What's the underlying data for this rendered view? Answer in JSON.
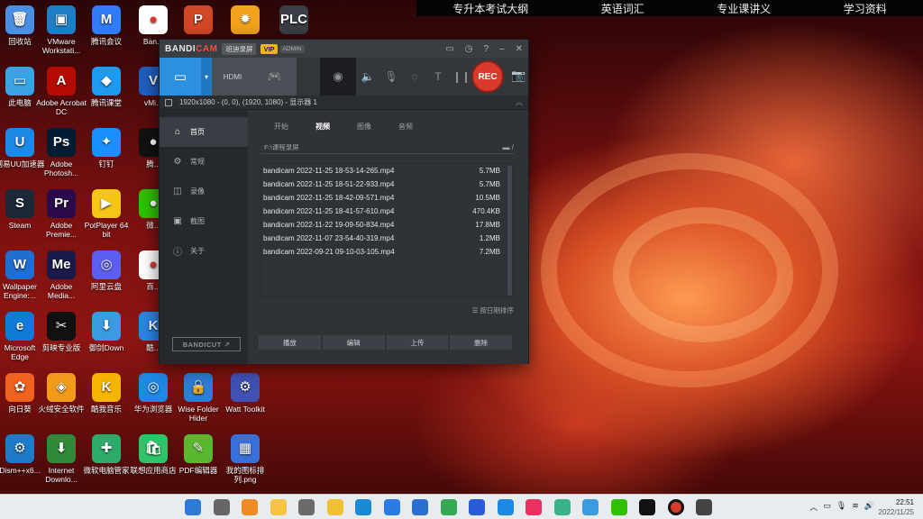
{
  "top_banner": [
    "专升本考试大纲",
    "英语词汇",
    "专业课讲义",
    "学习资料"
  ],
  "desktop_icons": [
    {
      "label": "回收站",
      "icon": "recycle-bin-icon",
      "color": "#4a90e2",
      "glyph": "🗑"
    },
    {
      "label": "VMware Workstati...",
      "icon": "vmware-icon",
      "color": "#1d7ec6",
      "glyph": "▣"
    },
    {
      "label": "腾讯会议",
      "icon": "tencent-meeting-icon",
      "color": "#2f7cf6",
      "glyph": "M"
    },
    {
      "label": "Ban...",
      "icon": "bandicam-icon",
      "color": "#ffffff",
      "glyph": "●"
    },
    {
      "label": "PowerPoint",
      "icon": "powerpoint-icon",
      "color": "#d24726",
      "glyph": "P"
    },
    {
      "label": "X1...",
      "icon": "x-app-icon",
      "color": "#f2a21b",
      "glyph": "✹"
    },
    {
      "label": "PLC SIM",
      "icon": "plcsim-icon",
      "color": "#3a3f46",
      "glyph": "PLC"
    },
    {
      "label": "此电脑",
      "icon": "this-pc-icon",
      "color": "#3aa3e3",
      "glyph": "▭"
    },
    {
      "label": "Adobe Acrobat DC",
      "icon": "acrobat-icon",
      "color": "#b30b00",
      "glyph": "A"
    },
    {
      "label": "腾讯课堂",
      "icon": "tencent-class-icon",
      "color": "#1e9bf0",
      "glyph": "◆"
    },
    {
      "label": "vMi...",
      "icon": "vmix-icon",
      "color": "#1f5fbf",
      "glyph": "V"
    },
    {
      "label": "网易UU加速器",
      "icon": "uu-accelerator-icon",
      "color": "#1e88e5",
      "glyph": "U"
    },
    {
      "label": "Adobe Photosh...",
      "icon": "photoshop-icon",
      "color": "#001d34",
      "glyph": "Ps"
    },
    {
      "label": "钉钉",
      "icon": "dingtalk-icon",
      "color": "#1890ff",
      "glyph": "✦"
    },
    {
      "label": "腾...",
      "icon": "tencent-app-icon",
      "color": "#111111",
      "glyph": "●"
    },
    {
      "label": "Steam",
      "icon": "steam-icon",
      "color": "#1b2838",
      "glyph": "S"
    },
    {
      "label": "Adobe Premie...",
      "icon": "premiere-icon",
      "color": "#2a0a4a",
      "glyph": "Pr"
    },
    {
      "label": "PotPlayer 64 bit",
      "icon": "potplayer-icon",
      "color": "#f5c518",
      "glyph": "▶"
    },
    {
      "label": "微...",
      "icon": "wechat-icon",
      "color": "#2dc100",
      "glyph": "●"
    },
    {
      "label": "Wallpaper Engine:...",
      "icon": "wallpaper-engine-icon",
      "color": "#1f6fd1",
      "glyph": "W"
    },
    {
      "label": "Adobe Media...",
      "icon": "media-encoder-icon",
      "color": "#1a1a4a",
      "glyph": "Me"
    },
    {
      "label": "阿里云盘",
      "icon": "aliyun-drive-icon",
      "color": "#5b5ff0",
      "glyph": "◎"
    },
    {
      "label": "百...",
      "icon": "baidu-icon",
      "color": "#ffffff",
      "glyph": "●"
    },
    {
      "label": "Microsoft Edge",
      "icon": "edge-icon",
      "color": "#0f7ad8",
      "glyph": "e"
    },
    {
      "label": "剪映专业版",
      "icon": "jianying-icon",
      "color": "#111111",
      "glyph": "✂"
    },
    {
      "label": "御剑Down",
      "icon": "down-icon",
      "color": "#3a9be0",
      "glyph": "⬇"
    },
    {
      "label": "酷...",
      "icon": "kugou-icon",
      "color": "#2a85e8",
      "glyph": "K"
    },
    {
      "label": "向日葵",
      "icon": "sunflower-icon",
      "color": "#f0621e",
      "glyph": "✿"
    },
    {
      "label": "火绒安全软件",
      "icon": "huorong-icon",
      "color": "#f29a1a",
      "glyph": "◈"
    },
    {
      "label": "酷我音乐",
      "icon": "kuwo-icon",
      "color": "#f5b400",
      "glyph": "K"
    },
    {
      "label": "华为浏览器",
      "icon": "huawei-browser-icon",
      "color": "#1e88e5",
      "glyph": "◎"
    },
    {
      "label": "Wise Folder Hider",
      "icon": "wise-folder-icon",
      "color": "#2e7dd6",
      "glyph": "🔒"
    },
    {
      "label": "Watt Toolkit",
      "icon": "watt-toolkit-icon",
      "color": "#3f51b5",
      "glyph": "⚙"
    },
    {
      "label": "Dism++x6...",
      "icon": "dism-icon",
      "color": "#1f7ac9",
      "glyph": "⚙"
    },
    {
      "label": "Internet Downlo...",
      "icon": "idm-icon",
      "color": "#2f8a3a",
      "glyph": "⬇"
    },
    {
      "label": "微软电脑管家",
      "icon": "pc-manager-icon",
      "color": "#2eaa6a",
      "glyph": "✚"
    },
    {
      "label": "联想应用商店",
      "icon": "lenovo-store-icon",
      "color": "#2dc46a",
      "glyph": "🛍"
    },
    {
      "label": "PDF编辑器",
      "icon": "pdf-editor-icon",
      "color": "#5ab82f",
      "glyph": "✎"
    },
    {
      "label": "我的图标排列.png",
      "icon": "png-file-icon",
      "color": "#3b6fd8",
      "glyph": "▦"
    }
  ],
  "bandicam": {
    "logo_prefix": "BANDI",
    "logo_suffix": "CAM",
    "chip_label": "班迪录屏",
    "vip_label": "VIP",
    "admin_label": "ADMIN",
    "region_text": "1920x1080 - (0, 0), (1920, 1080) - 显示器 1",
    "rec_label": "REC",
    "hdmi_label": "HDMI",
    "sidebar": [
      {
        "label": "首页",
        "icon": "home-icon",
        "glyph": "⌂",
        "active": true
      },
      {
        "label": "常规",
        "icon": "gear-icon",
        "glyph": "⚙",
        "active": false
      },
      {
        "label": "录像",
        "icon": "video-record-icon",
        "glyph": "◫",
        "active": false
      },
      {
        "label": "截图",
        "icon": "screenshot-icon",
        "glyph": "▣",
        "active": false
      },
      {
        "label": "关于",
        "icon": "info-icon",
        "glyph": "ⓘ",
        "active": false
      }
    ],
    "bandicut_label": "BANDICUT",
    "tabs": [
      {
        "label": "开始",
        "active": false
      },
      {
        "label": "视频",
        "active": true
      },
      {
        "label": "图像",
        "active": false
      },
      {
        "label": "音频",
        "active": false
      }
    ],
    "path": "F:\\课程录屏",
    "files": [
      {
        "name": "bandicam 2022-11-25 18-53-14-265.mp4",
        "size": "5.7MB"
      },
      {
        "name": "bandicam 2022-11-25 18-51-22-933.mp4",
        "size": "5.7MB"
      },
      {
        "name": "bandicam 2022-11-25 18-42-09-571.mp4",
        "size": "10.5MB"
      },
      {
        "name": "bandicam 2022-11-25 18-41-57-610.mp4",
        "size": "470.4KB"
      },
      {
        "name": "bandicam 2022-11-22 19-09-50-834.mp4",
        "size": "17.8MB"
      },
      {
        "name": "bandicam 2022-11-07 23-54-40-319.mp4",
        "size": "1.2MB"
      },
      {
        "name": "bandicam 2022-09-21 09-10-03-105.mp4",
        "size": "7.2MB"
      }
    ],
    "sort_label": "按日期排序",
    "actions": [
      "播放",
      "编辑",
      "上传",
      "删除"
    ]
  },
  "taskbar": {
    "clock_time": "22:51",
    "clock_date": "2022/11/25",
    "icons": [
      {
        "name": "start-icon",
        "color": "#2c7ad6"
      },
      {
        "name": "task-view-icon",
        "color": "#666666"
      },
      {
        "name": "search-icon",
        "color": "#f08a24"
      },
      {
        "name": "file-explorer-icon",
        "color": "#f5c542"
      },
      {
        "name": "settings-icon",
        "color": "#6a6a6a"
      },
      {
        "name": "notes-icon",
        "color": "#f0c030"
      },
      {
        "name": "edge-icon",
        "color": "#1a8ad4"
      },
      {
        "name": "kugou-icon",
        "color": "#2a7be4"
      },
      {
        "name": "l-app-icon",
        "color": "#2a6fd0"
      },
      {
        "name": "chrome-icon",
        "color": "#34a853"
      },
      {
        "name": "store-icon",
        "color": "#2a5bd7"
      },
      {
        "name": "browser-icon",
        "color": "#1e88e5"
      },
      {
        "name": "video-app-icon",
        "color": "#e8315f"
      },
      {
        "name": "grid-app-icon",
        "color": "#3bb38a"
      },
      {
        "name": "photos-icon",
        "color": "#3a9be0"
      },
      {
        "name": "wechat-icon",
        "color": "#2dc100"
      },
      {
        "name": "qq-icon",
        "color": "#111111"
      },
      {
        "name": "bandicam-taskbar-icon",
        "color": "#d83a2b"
      },
      {
        "name": "app-icon",
        "color": "#444444"
      }
    ]
  }
}
